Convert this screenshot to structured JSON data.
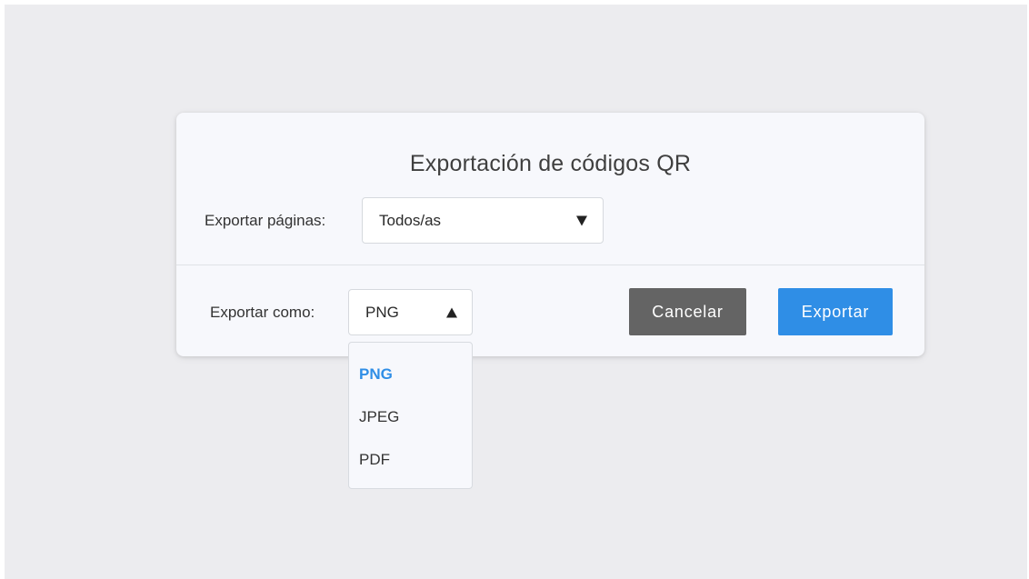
{
  "colors": {
    "backdrop": "#ececef",
    "dialog_bg": "#f7f8fc",
    "cancel_button": "#646464",
    "export_button": "#2f8ee6",
    "selected_option": "#2f8ee6"
  },
  "dialog": {
    "title": "Exportación de códigos QR",
    "pages": {
      "label": "Exportar páginas:",
      "value": "Todos/as",
      "caret_icon": "triangle-down"
    },
    "format": {
      "label": "Exportar como:",
      "value": "PNG",
      "caret_icon": "triangle-up",
      "expanded": true,
      "options": [
        {
          "label": "PNG",
          "selected": true
        },
        {
          "label": "JPEG",
          "selected": false
        },
        {
          "label": "PDF",
          "selected": false
        }
      ]
    },
    "buttons": {
      "cancel": "Cancelar",
      "export": "Exportar"
    }
  }
}
